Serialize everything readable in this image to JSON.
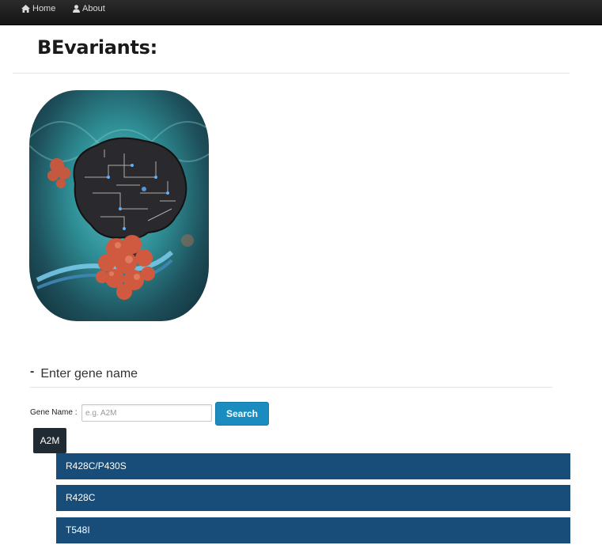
{
  "nav": {
    "home_label": "Home",
    "about_label": "About"
  },
  "header": {
    "title": "BEvariants:"
  },
  "section": {
    "toggle": "-",
    "title": "Enter gene name"
  },
  "search": {
    "label": "Gene Name :",
    "placeholder": "e.g. A2M",
    "value": "",
    "button_label": "Search"
  },
  "result": {
    "gene": "A2M",
    "variants": [
      "R428C/P430S",
      "R428C",
      "T548I"
    ]
  },
  "colors": {
    "navbar": "#1a1a1a",
    "search_button": "#1a8cc0",
    "gene_tag": "#1f2a33",
    "variant_bar": "#174d78"
  }
}
